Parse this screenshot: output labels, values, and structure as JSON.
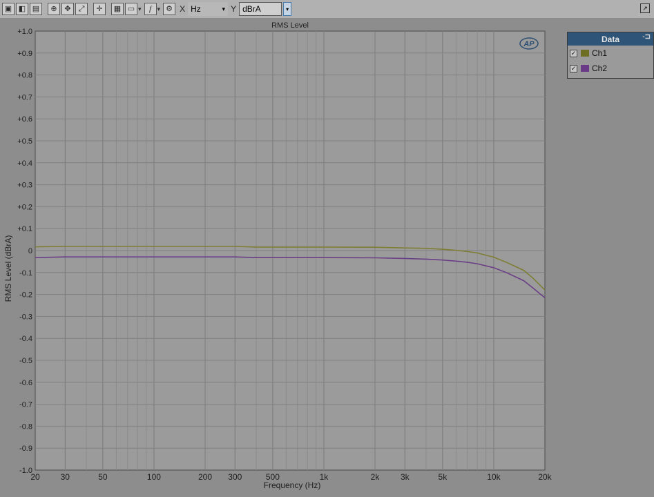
{
  "toolbar": {
    "buttons": [
      {
        "name": "save-graph-icon",
        "glyph": "▣"
      },
      {
        "name": "open-graph-icon",
        "glyph": "◧"
      },
      {
        "name": "print-icon",
        "glyph": "▤"
      },
      {
        "name": "zoom-icon",
        "glyph": "⊕"
      },
      {
        "name": "pan-icon",
        "glyph": "✥"
      },
      {
        "name": "fit-icon",
        "glyph": "⤢"
      },
      {
        "name": "cursor-icon",
        "glyph": "✛"
      },
      {
        "name": "table-icon",
        "glyph": "▦"
      },
      {
        "name": "graph-options-icon",
        "glyph": "▭"
      },
      {
        "name": "fx-icon",
        "glyph": "f"
      },
      {
        "name": "settings-icon",
        "glyph": "⚙"
      }
    ],
    "x_label": "X",
    "x_unit": "Hz",
    "y_label": "Y",
    "y_unit": "dBrA",
    "dropdown_glyph": "▾"
  },
  "chart_data": {
    "type": "line",
    "title": "RMS Level",
    "xlabel": "Frequency (Hz)",
    "ylabel": "RMS Level (dBrA)",
    "xscale": "log",
    "xlim": [
      20,
      20000
    ],
    "ylim": [
      -1.0,
      1.0
    ],
    "grid": true,
    "legend_position": "right",
    "logo": "AP",
    "x_ticks": [
      {
        "value": 20,
        "label": "20"
      },
      {
        "value": 30,
        "label": "30"
      },
      {
        "value": 50,
        "label": "50"
      },
      {
        "value": 100,
        "label": "100"
      },
      {
        "value": 200,
        "label": "200"
      },
      {
        "value": 300,
        "label": "300"
      },
      {
        "value": 500,
        "label": "500"
      },
      {
        "value": 1000,
        "label": "1k"
      },
      {
        "value": 2000,
        "label": "2k"
      },
      {
        "value": 3000,
        "label": "3k"
      },
      {
        "value": 5000,
        "label": "5k"
      },
      {
        "value": 10000,
        "label": "10k"
      },
      {
        "value": 20000,
        "label": "20k"
      }
    ],
    "y_ticks": [
      {
        "value": 1.0,
        "label": "+1.0"
      },
      {
        "value": 0.9,
        "label": "+0.9"
      },
      {
        "value": 0.8,
        "label": "+0.8"
      },
      {
        "value": 0.7,
        "label": "+0.7"
      },
      {
        "value": 0.6,
        "label": "+0.6"
      },
      {
        "value": 0.5,
        "label": "+0.5"
      },
      {
        "value": 0.4,
        "label": "+0.4"
      },
      {
        "value": 0.3,
        "label": "+0.3"
      },
      {
        "value": 0.2,
        "label": "+0.2"
      },
      {
        "value": 0.1,
        "label": "+0.1"
      },
      {
        "value": 0,
        "label": "0"
      },
      {
        "value": -0.1,
        "label": "-0.1"
      },
      {
        "value": -0.2,
        "label": "-0.2"
      },
      {
        "value": -0.3,
        "label": "-0.3"
      },
      {
        "value": -0.4,
        "label": "-0.4"
      },
      {
        "value": -0.5,
        "label": "-0.5"
      },
      {
        "value": -0.6,
        "label": "-0.6"
      },
      {
        "value": -0.7,
        "label": "-0.7"
      },
      {
        "value": -0.8,
        "label": "-0.8"
      },
      {
        "value": -0.9,
        "label": "-0.9"
      },
      {
        "value": -1.0,
        "label": "-1.0"
      }
    ],
    "series": [
      {
        "name": "Ch1",
        "color": "#7e7e34",
        "x": [
          20,
          30,
          50,
          100,
          200,
          300,
          400,
          500,
          1000,
          2000,
          3000,
          4000,
          5000,
          6000,
          7000,
          8000,
          10000,
          12000,
          15000,
          17000,
          20000
        ],
        "y": [
          0.017,
          0.019,
          0.019,
          0.019,
          0.019,
          0.019,
          0.016,
          0.016,
          0.016,
          0.015,
          0.012,
          0.01,
          0.006,
          0.001,
          -0.004,
          -0.011,
          -0.03,
          -0.055,
          -0.09,
          -0.125,
          -0.18
        ]
      },
      {
        "name": "Ch2",
        "color": "#6b3f86",
        "x": [
          20,
          30,
          50,
          100,
          200,
          300,
          400,
          500,
          1000,
          2000,
          3000,
          4000,
          5000,
          6000,
          7000,
          8000,
          10000,
          12000,
          15000,
          17000,
          20000
        ],
        "y": [
          -0.032,
          -0.029,
          -0.029,
          -0.029,
          -0.029,
          -0.029,
          -0.032,
          -0.032,
          -0.032,
          -0.033,
          -0.036,
          -0.039,
          -0.043,
          -0.048,
          -0.053,
          -0.06,
          -0.078,
          -0.102,
          -0.137,
          -0.17,
          -0.215
        ]
      }
    ]
  },
  "legend": {
    "title": "Data",
    "pin_glyph": "-⊐",
    "check_glyph": "✓"
  }
}
